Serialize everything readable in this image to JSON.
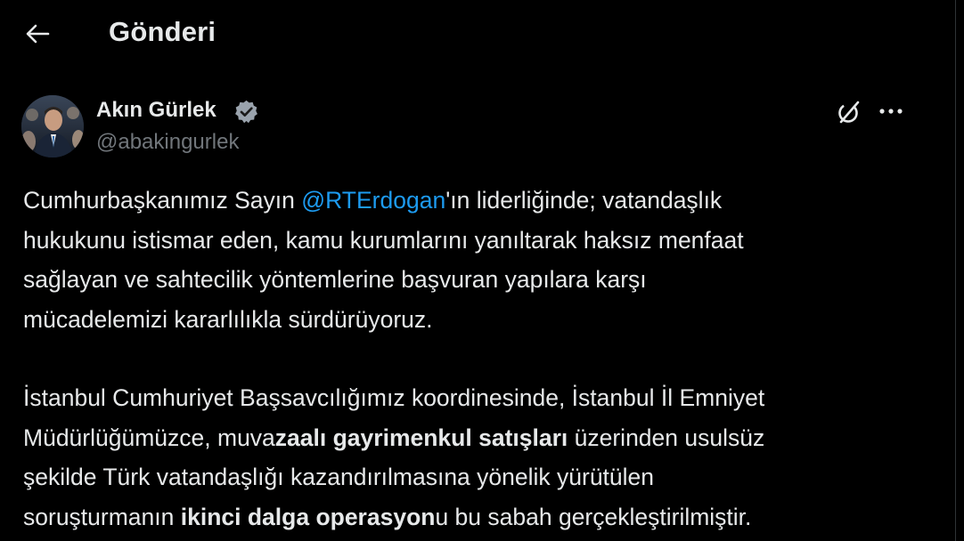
{
  "header": {
    "title": "Gönderi"
  },
  "author": {
    "name": "Akın Gürlek",
    "handle": "@abakingurlek"
  },
  "icons": {
    "back": "arrow-left-icon",
    "verified": "verified-badge-icon",
    "grok": "grok-icon",
    "more": "more-horizontal-icon"
  },
  "colors": {
    "background": "#000000",
    "text": "#e7e9ea",
    "muted": "#71767b",
    "accent": "#1d9bf0"
  },
  "tweet": {
    "p1": {
      "before_mention": "Cumhurbaşkanımız Sayın ",
      "mention": "@RTErdogan",
      "line1_after": "'ın liderliğinde; vatandaşlık",
      "line2": "hukukunu istismar eden, kamu kurumlarını yanıltarak haksız menfaat",
      "line3": "sağlayan ve sahtecilik yöntemlerine başvuran yapılara karşı",
      "line4": "mücadelemizi kararlılıkla sürdürüyoruz."
    },
    "p2": {
      "line1": "İstanbul Cumhuriyet Başsavcılığımız koordinesinde, İstanbul İl Emniyet",
      "line2_pre": "Müdürlüğümüzce, muva",
      "line2_bold": "zaalı gayrimenkul satışları",
      "line2_post": " üzerinden usulsüz",
      "line3": "şekilde Türk vatandaşlığı kazandırılmasına yönelik yürütülen",
      "line4_pre": "soruşturmanın ",
      "line4_bold": "ikinci dalga operasyon",
      "line4_post": "u bu sabah gerçekleştirilmiştir."
    }
  }
}
